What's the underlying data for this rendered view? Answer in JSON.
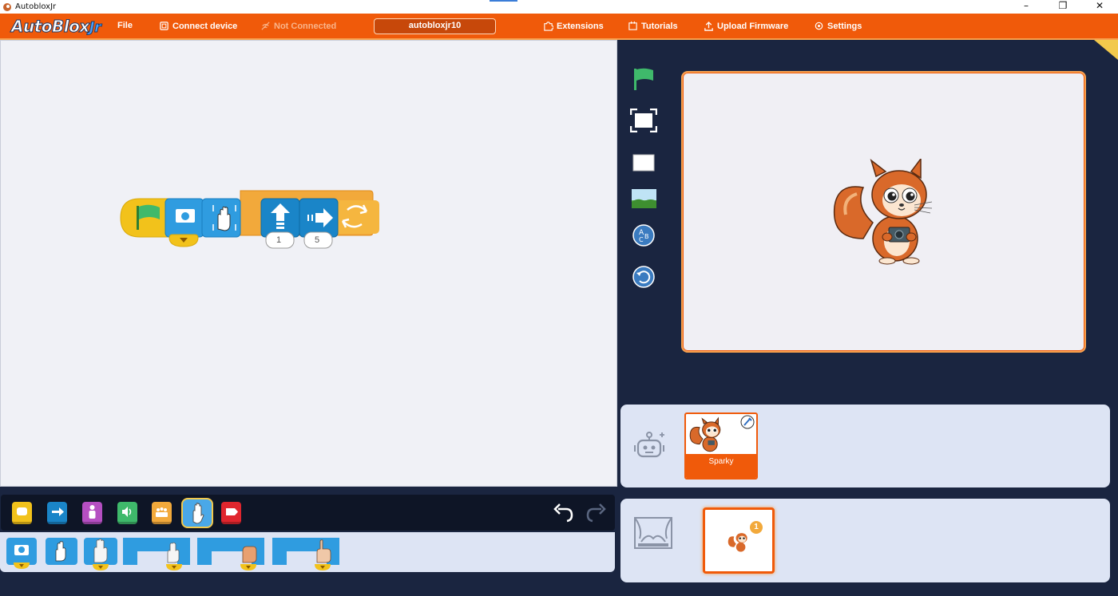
{
  "window": {
    "title": "AutobloxJr",
    "controls": [
      "–",
      "❐",
      "✕"
    ]
  },
  "nav": {
    "logo_main": "AutoBlox",
    "logo_suffix": "Jr",
    "file": "File",
    "connect": "Connect device",
    "status": "Not Connected",
    "device_name": "autobloxjr10",
    "extensions": "Extensions",
    "tutorials": "Tutorials",
    "upload": "Upload Firmware",
    "settings": "Settings"
  },
  "script": {
    "move_up_value": "1",
    "move_right_value": "5"
  },
  "categories": [
    {
      "name": "triggers",
      "color": "#f2c21b"
    },
    {
      "name": "motion",
      "color": "#1a85c8"
    },
    {
      "name": "looks",
      "color": "#b54fc2"
    },
    {
      "name": "sound",
      "color": "#3fb96b"
    },
    {
      "name": "control",
      "color": "#f2a93b"
    },
    {
      "name": "gestures",
      "color": "#4aa8e8"
    },
    {
      "name": "end",
      "color": "#e0262e"
    }
  ],
  "sprite": {
    "name": "Sparky"
  },
  "scene": {
    "badge": "1"
  }
}
